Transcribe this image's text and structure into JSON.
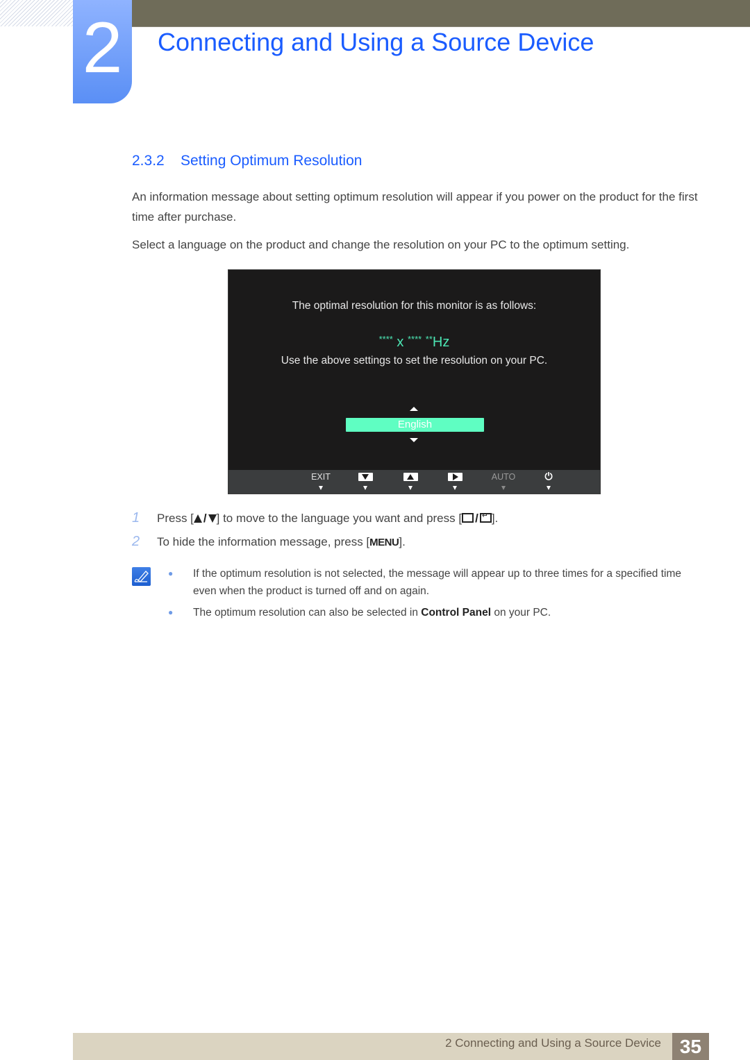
{
  "chapter": {
    "number": "2",
    "title": "Connecting and Using a Source Device"
  },
  "section": {
    "number": "2.3.2",
    "title": "Setting Optimum Resolution"
  },
  "paragraphs": [
    "An information message about setting optimum resolution will appear if you power on the product for the first time after purchase.",
    "Select a language on the product and change the resolution on your PC to the optimum setting."
  ],
  "osd": {
    "line1": "The optimal resolution for this monitor is as follows:",
    "res_w": "****",
    "res_x": "x",
    "res_h": "****",
    "res_hz_stars": "**",
    "res_hz": "Hz",
    "line2": "Use the above settings to set the resolution on your PC.",
    "language_selected": "English",
    "buttons": [
      {
        "label": "EXIT",
        "icon": "exit-text"
      },
      {
        "label": "",
        "icon": "down-arrow-key"
      },
      {
        "label": "",
        "icon": "up-arrow-key"
      },
      {
        "label": "",
        "icon": "right-arrow-key"
      },
      {
        "label": "AUTO",
        "icon": "auto-text"
      },
      {
        "label": "⏻",
        "icon": "power-icon"
      }
    ],
    "colors": {
      "background": "#1b1a1a",
      "accent": "#5ffec2",
      "resolution_text": "#4ce6b4"
    }
  },
  "steps": [
    {
      "num": "1",
      "pre": "Press [",
      "mid": "] to move to the language you want and press [",
      "post": "]."
    },
    {
      "num": "2",
      "pre": "To hide the information message, press [",
      "key": "MENU",
      "post": "]."
    }
  ],
  "notes": [
    {
      "text": "If the optimum resolution is not selected, the message will appear up to three times for a specified time even when the product is turned off and on again."
    },
    {
      "pre": "The optimum resolution can also be selected in ",
      "bold": "Control Panel",
      "post": " on your PC."
    }
  ],
  "footer": {
    "text": "2 Connecting and Using a Source Device",
    "page": "35"
  }
}
